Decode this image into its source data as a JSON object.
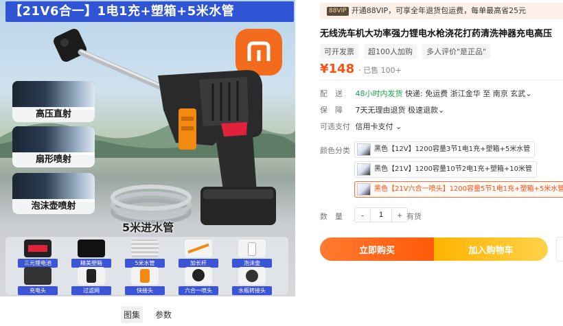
{
  "gallery": {
    "banner": "【21V6合一】1电1充+塑箱+5米水管",
    "modes": [
      "高压直射",
      "扇形喷射",
      "泡沫壶喷射"
    ],
    "hose_label": "5米进水管",
    "accessories": [
      "三元锂电池",
      "精美塑箱",
      "5米水管",
      "加长杆",
      "泡沫壶",
      "充电头",
      "过滤网",
      "快接头",
      "六合一喷头",
      "水瓶转接头"
    ],
    "tabs": [
      "图集",
      "参数"
    ]
  },
  "vip": {
    "tag": "88VIP",
    "text": "开通88VIP，可享全年退货包运费，每单最高省25元"
  },
  "product": {
    "title": "无线洗车机大功率强力锂电水枪浇花打药清洗神器充电高压",
    "chips": [
      "可开发票",
      "超100人加购",
      "多人评价\"是正品\""
    ],
    "price": "¥148",
    "sold": "· 已售 100+"
  },
  "delivery": {
    "label": "配　送",
    "highlight": "48小时内发货",
    "text": "快递: 免运费  浙江金华 至 南京 玄武⌄"
  },
  "guarantee": {
    "label": "保　障",
    "text": "7天无理由退货  极速退款⌄"
  },
  "payment": {
    "label": "可选支付",
    "text": "信用卡支付 ⌄"
  },
  "color": {
    "label": "颜色分类",
    "options": [
      "黑色【12V】1200容量3节1电1充+塑箱+5米水管",
      "黑色【21V】1200容量10节2电1充+塑箱+10米管",
      "黑色【21V六合一喷头】1200容量5节1电1充+塑箱+5米水管"
    ],
    "selected_index": 2
  },
  "quantity": {
    "label": "数　量",
    "minus": "-",
    "value": "1",
    "plus": "+",
    "stock": "有货"
  },
  "actions": {
    "buy": "立即购买",
    "cart": "加入购物车"
  },
  "colors": {
    "price": "#ff4f0f",
    "banner": "#2f55d4",
    "brand_logo": "#f36b1c",
    "buy_button": "#ff5a0a",
    "cart_button": "#ffb400"
  }
}
